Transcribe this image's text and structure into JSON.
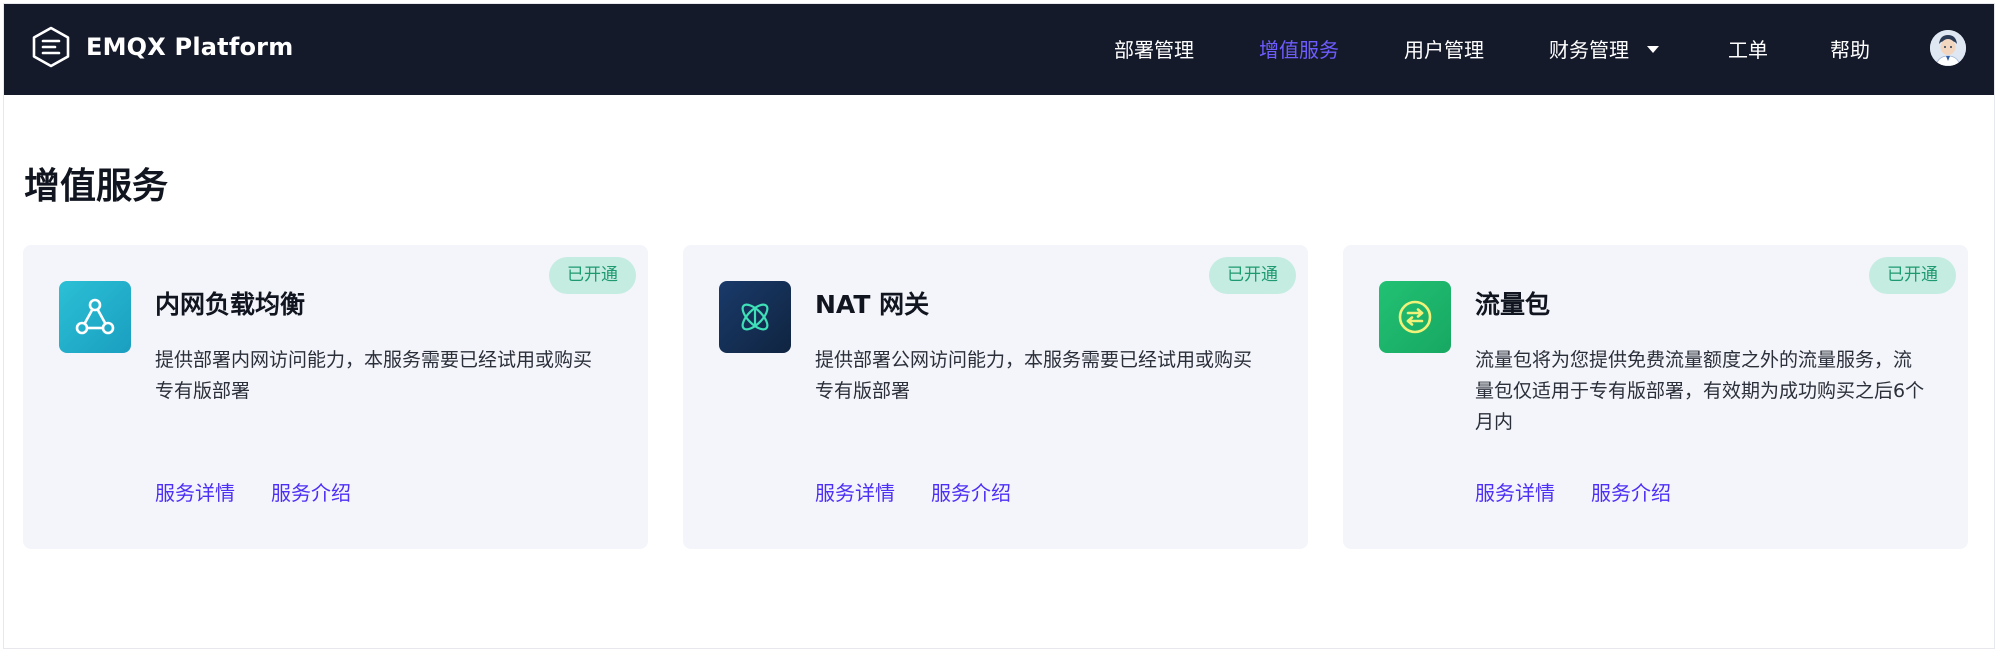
{
  "app": {
    "name": "EMQX Platform"
  },
  "nav": {
    "items": [
      {
        "label": "部署管理",
        "active": false
      },
      {
        "label": "增值服务",
        "active": true
      },
      {
        "label": "用户管理",
        "active": false
      },
      {
        "label": "财务管理",
        "active": false,
        "has_dropdown": true
      },
      {
        "label": "工单",
        "active": false
      },
      {
        "label": "帮助",
        "active": false
      }
    ]
  },
  "page": {
    "title": "增值服务"
  },
  "cards": [
    {
      "name": "内网负载均衡",
      "status": "已开通",
      "description": "提供部署内网访问能力，本服务需要已经试用或购买专有版部署",
      "links": {
        "details": "服务详情",
        "intro": "服务介绍"
      },
      "icon": "load-balancer-icon"
    },
    {
      "name": "NAT 网关",
      "status": "已开通",
      "description": "提供部署公网访问能力，本服务需要已经试用或购买专有版部署",
      "links": {
        "details": "服务详情",
        "intro": "服务介绍"
      },
      "icon": "nat-gateway-icon"
    },
    {
      "name": "流量包",
      "status": "已开通",
      "description": "流量包将为您提供免费流量额度之外的流量服务，流量包仅适用于专有版部署，有效期为成功购买之后6个月内",
      "links": {
        "details": "服务详情",
        "intro": "服务介绍"
      },
      "icon": "traffic-package-icon"
    }
  ],
  "colors": {
    "topbar": "#151a2b",
    "accent": "#6f5cff",
    "link": "#4c2ff5",
    "badge_bg": "#c4ece0",
    "badge_text": "#1f9a70",
    "card_bg": "#f4f5fa"
  }
}
